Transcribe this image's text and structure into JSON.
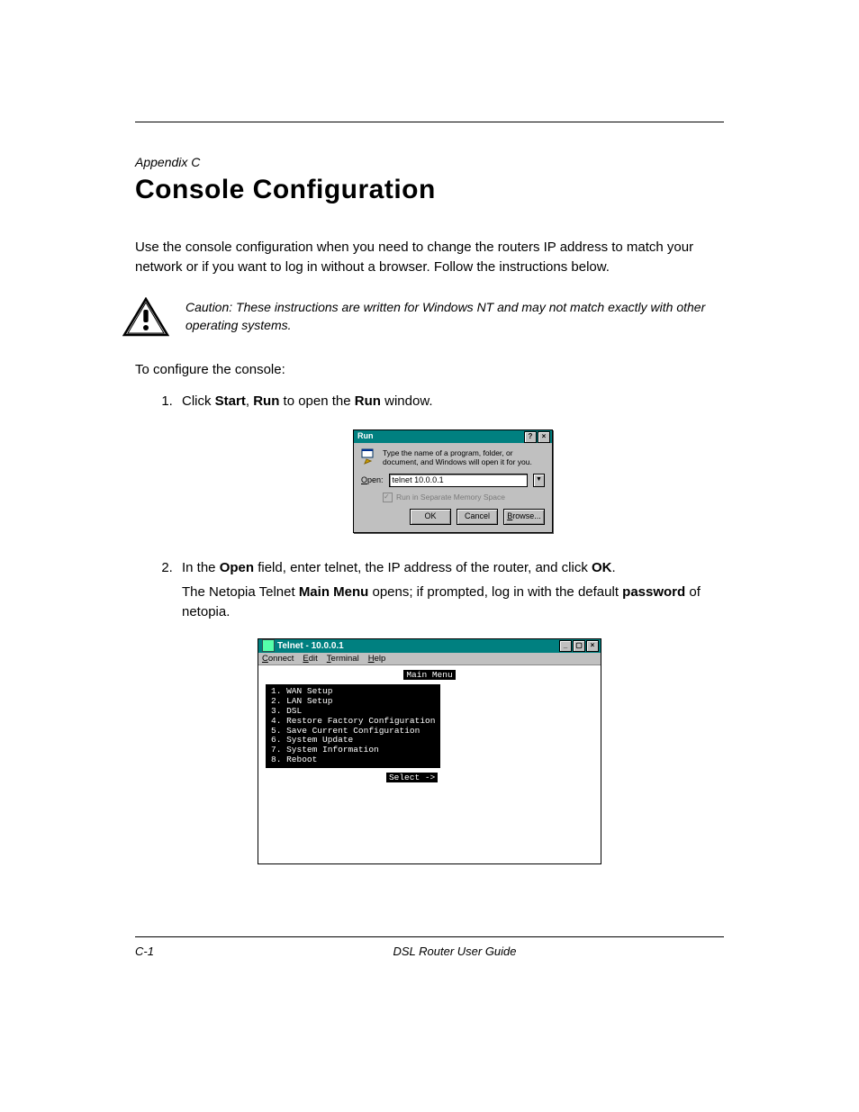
{
  "header": {
    "appendix_label": "Appendix C",
    "title": "Console Configuration"
  },
  "intro": {
    "p1": "Use the console configuration when you need to change the routers IP address to match your network or if you want to log in without a browser. Follow the instructions below.",
    "caution": "Caution: These instructions are written for Windows NT and may not match exactly with other operating systems.",
    "p2": "To configure the console:"
  },
  "steps": {
    "s1_a": "Click ",
    "s1_b": "Start",
    "s1_c": ", ",
    "s1_d": "Run",
    "s1_e": " to open the ",
    "s1_f": "Run",
    "s1_g": " window.",
    "s2_a": "In the ",
    "s2_b": "Open",
    "s2_c": " field, enter telnet, the IP address of the router, and click ",
    "s2_d": "OK",
    "s2_e": ".",
    "s2_cont_a": "The Netopia Telnet ",
    "s2_cont_b": "Main Menu",
    "s2_cont_c": " opens; if prompted, log in with the default ",
    "s2_cont_d": "password",
    "s2_cont_e": " of netopia."
  },
  "run_dialog": {
    "title": "Run",
    "message": "Type the name of a program, folder, or document, and Windows will open it for you.",
    "open_label": "Open:",
    "open_value": "telnet 10.0.0.1",
    "mem_checkbox": "Run in Separate Memory Space",
    "btn_ok": "OK",
    "btn_cancel": "Cancel",
    "btn_browse": "Browse..."
  },
  "telnet": {
    "title": "Telnet - 10.0.0.1",
    "menubar": {
      "connect": "Connect",
      "edit": "Edit",
      "terminal": "Terminal",
      "help": "Help"
    },
    "main_menu_label": "Main Menu",
    "items": [
      "1. WAN Setup",
      "2. LAN Setup",
      "3. DSL",
      "4. Restore Factory Configuration",
      "5. Save Current Configuration",
      "6. System Update",
      "7. System Information",
      "8. Reboot"
    ],
    "select_label": "Select  ->"
  },
  "footer": {
    "page": "C-1",
    "title": "DSL Router User Guide"
  }
}
